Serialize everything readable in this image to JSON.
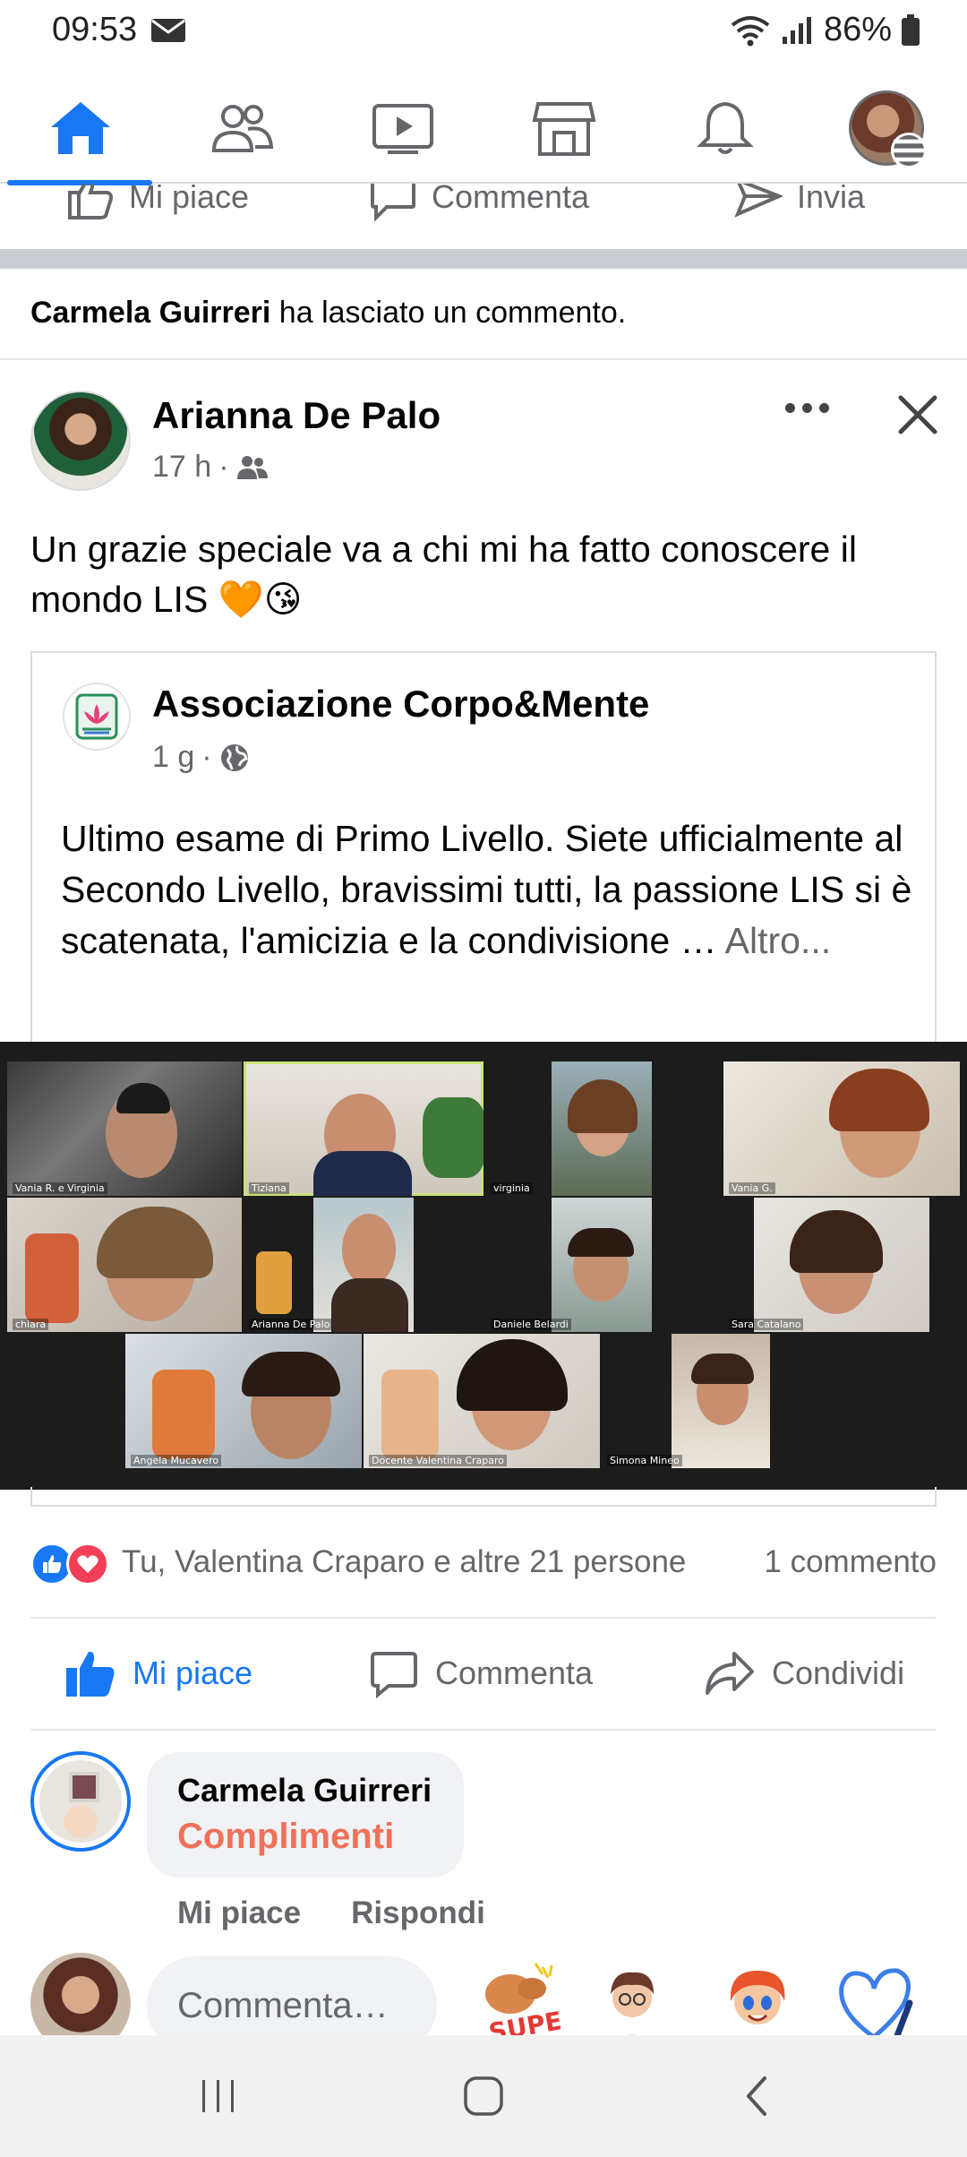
{
  "status_bar": {
    "time": "09:53",
    "battery": "86%",
    "icons": [
      "mail-icon",
      "wifi-icon",
      "signal-icon",
      "battery-icon"
    ]
  },
  "nav": {
    "items": [
      {
        "name": "home",
        "icon": "home-icon",
        "active": true
      },
      {
        "name": "friends",
        "icon": "friends-icon"
      },
      {
        "name": "watch",
        "icon": "video-icon"
      },
      {
        "name": "marketplace",
        "icon": "store-icon"
      },
      {
        "name": "notifications",
        "icon": "bell-icon"
      },
      {
        "name": "menu",
        "icon": "profile-menu-icon"
      }
    ]
  },
  "prev_post_actions": {
    "like": "Mi piace",
    "comment": "Commenta",
    "send": "Invia"
  },
  "notice": {
    "actor": "Carmela Guirreri",
    "text": " ha lasciato un commento."
  },
  "post": {
    "author": "Arianna De Palo",
    "time": "17 h",
    "separator": "·",
    "audience_icon": "friends-icon",
    "text": "Un grazie speciale va a chi mi ha fatto conoscere il mondo LIS 🧡😘",
    "shared": {
      "author": "Associazione Corpo&Mente",
      "time": "1 g",
      "separator": "·",
      "audience_icon": "globe-icon",
      "text": "Ultimo esame di Primo Livello. Siete ufficialmente al Secondo Livello, bravissimi tutti, la passione LIS si è scatenata, l'amicizia e la condivisione … ",
      "more": "Altro...",
      "video_tiles": [
        {
          "label": "Vania R. e Virginia"
        },
        {
          "label": "Tiziana"
        },
        {
          "label": "virginia"
        },
        {
          "label": "Vania G."
        },
        {
          "label": "chiara"
        },
        {
          "label": "Arianna De Palo"
        },
        {
          "label": "Daniele Belardi"
        },
        {
          "label": "Sara Catalano"
        },
        {
          "label": "Angela Mucavero"
        },
        {
          "label": "Docente Valentina Craparo"
        },
        {
          "label": "Simona Mineo"
        }
      ]
    },
    "reactions_text": "Tu, Valentina Craparo e altre 21 persone",
    "comments_count": "1 commento",
    "actions": {
      "like": "Mi piace",
      "comment": "Commenta",
      "share": "Condividi"
    }
  },
  "comment": {
    "author": "Carmela Guirreri",
    "text": "Complimenti",
    "like": "Mi piace",
    "reply": "Rispondi"
  },
  "compose": {
    "placeholder": "Commenta…"
  },
  "colors": {
    "brand": "#1877f2",
    "comment_text": "#f0715a",
    "love": "#f33e58"
  }
}
